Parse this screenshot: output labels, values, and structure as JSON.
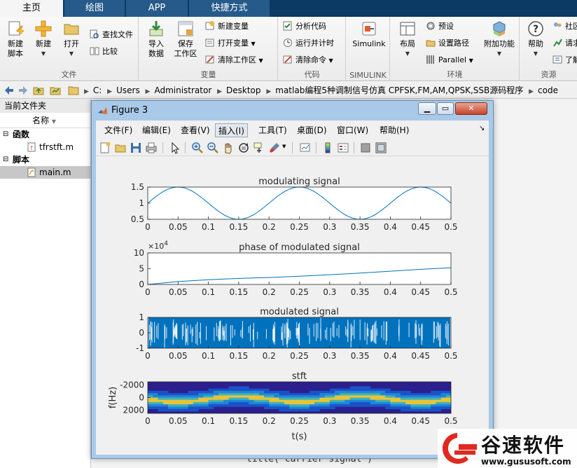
{
  "ribbon": {
    "tabs": [
      "主页",
      "绘图",
      "APP",
      "快捷方式"
    ],
    "active_tab": "主页",
    "groups": {
      "file": {
        "label": "文件",
        "new_script": "新建\n脚本",
        "new": "新建",
        "open": "打开",
        "find_files": "查找文件",
        "compare": "比较"
      },
      "variable": {
        "label": "变量",
        "import_data": "导入\n数据",
        "save_workspace": "保存\n工作区",
        "new_variable": "新建变量",
        "open_variable": "打开变量",
        "clear_workspace": "清除工作区"
      },
      "code": {
        "label": "代码",
        "analyze_code": "分析代码",
        "run_and_time": "运行并计时",
        "clear_commands": "清除命令"
      },
      "simulink": {
        "label": "SIMULINK",
        "simulink": "Simulink"
      },
      "environment": {
        "label": "环境",
        "layout": "布局",
        "preferences": "预设",
        "set_path": "设置路径",
        "parallel": "Parallel",
        "add_ons": "附加功能"
      },
      "resources": {
        "label": "资源",
        "help": "帮助",
        "community": "社区",
        "request_support": "请求",
        "learn": "了解"
      }
    }
  },
  "address_bar": {
    "path": [
      "C:",
      "Users",
      "Administrator",
      "Desktop",
      "matlab编程5种调制信号仿真 CPFSK,FM,AM,QPSK,SSB源码程序",
      "code"
    ]
  },
  "file_panel": {
    "title": "当前文件夹",
    "column_header": "名称",
    "sections": [
      {
        "label": "函数",
        "files": [
          "tfrstft.m"
        ]
      },
      {
        "label": "脚本",
        "files": [
          "main.m"
        ]
      }
    ]
  },
  "editor": {
    "visible_line": "title('carrier signal')"
  },
  "figure": {
    "title": "Figure 3",
    "menu": [
      "文件(F)",
      "编辑(E)",
      "查看(V)",
      "插入(I)",
      "工具(T)",
      "桌面(D)",
      "窗口(W)",
      "帮助(H)"
    ],
    "hovered_menu": "插入(I)",
    "toolbar_icons": [
      "new-figure-icon",
      "open-file-icon",
      "save-icon",
      "print-icon",
      "arrow-pointer-icon",
      "zoom-in-icon",
      "zoom-out-icon",
      "pan-hand-icon",
      "rotate-3d-icon",
      "data-cursor-icon",
      "brush-icon",
      "link-plot-icon",
      "colorbar-icon",
      "legend-icon",
      "hide-plot-tools-icon",
      "show-plot-tools-icon"
    ]
  },
  "chart_data": [
    {
      "type": "line",
      "title": "modulating signal",
      "xlabel": "",
      "ylabel": "",
      "xlim": [
        0,
        0.5
      ],
      "ylim": [
        0.5,
        1.5
      ],
      "xticks": [
        "0",
        "0.05",
        "0.1",
        "0.15",
        "0.2",
        "0.25",
        "0.3",
        "0.35",
        "0.4",
        "0.45",
        "0.5"
      ],
      "yticks": [
        "0.5",
        "1",
        "1.5"
      ],
      "series": [
        {
          "x": [
            0,
            0.05,
            0.1,
            0.15,
            0.2,
            0.25,
            0.3,
            0.35,
            0.4,
            0.45,
            0.5
          ],
          "y": [
            1,
            1.5,
            1,
            0.5,
            1,
            1.5,
            1,
            0.5,
            1,
            1.5,
            1
          ],
          "color": "#0072bd"
        }
      ]
    },
    {
      "type": "line",
      "title": "phase of modulated signal",
      "exponent_label": "×10^4",
      "xlabel": "",
      "ylabel": "",
      "xlim": [
        0,
        0.5
      ],
      "ylim": [
        0,
        10
      ],
      "xticks": [
        "0",
        "0.05",
        "0.1",
        "0.15",
        "0.2",
        "0.25",
        "0.3",
        "0.35",
        "0.4",
        "0.45",
        "0.5"
      ],
      "yticks": [
        "0",
        "5",
        "10"
      ],
      "series": [
        {
          "x": [
            0,
            0.05,
            0.1,
            0.15,
            0.2,
            0.25,
            0.3,
            0.35,
            0.4,
            0.45,
            0.5
          ],
          "y": [
            0,
            0.9,
            1.5,
            1.9,
            2.2,
            2.6,
            3.1,
            3.6,
            4.2,
            4.8,
            5.3
          ],
          "color": "#0072bd"
        }
      ]
    },
    {
      "type": "area",
      "title": "modulated signal",
      "xlabel": "",
      "ylabel": "",
      "xlim": [
        0,
        0.5
      ],
      "ylim": [
        -1,
        1
      ],
      "xticks": [
        "0",
        "0.05",
        "0.1",
        "0.15",
        "0.2",
        "0.25",
        "0.3",
        "0.35",
        "0.4",
        "0.45",
        "0.5"
      ],
      "yticks": [
        "-1",
        "0",
        "1"
      ],
      "series": [
        {
          "y_range": [
            -1,
            1
          ],
          "color": "#0072bd"
        }
      ]
    },
    {
      "type": "heatmap",
      "title": "stft",
      "xlabel": "t(s)",
      "ylabel": "f(Hz)",
      "xlim": [
        0,
        0.5
      ],
      "ylim": [
        -2500,
        2500
      ],
      "xticks": [
        "0",
        "0.05",
        "0.1",
        "0.15",
        "0.2",
        "0.25",
        "0.3",
        "0.35",
        "0.4",
        "0.45",
        "0.5"
      ],
      "yticks": [
        "-2000",
        "0",
        "2000"
      ],
      "colors": [
        "#2a1f8c",
        "#1b52c7",
        "#1d86d9",
        "#3fb1b7",
        "#e6c43a"
      ]
    }
  ],
  "watermark": {
    "brand": "谷速软件",
    "url": "www.gususoft.com"
  }
}
